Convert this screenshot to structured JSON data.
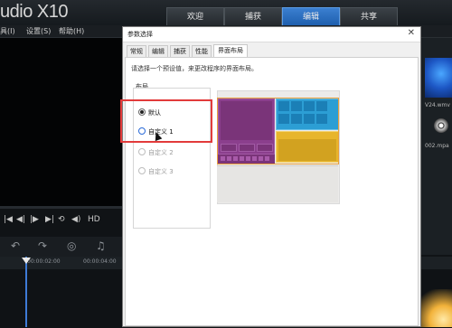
{
  "app": {
    "title": "udio X10",
    "mode_tabs": [
      "欢迎",
      "捕获",
      "编辑",
      "共享"
    ],
    "menu": [
      "具(I)",
      "设置(S)",
      "帮助(H)"
    ],
    "controls": [
      "HD"
    ],
    "ruler": [
      "00:00:02:00",
      "00:00:04:00"
    ],
    "thumb_labels": [
      "V24.wmv",
      "002.mpa"
    ],
    "accent": "#2d7bd8"
  },
  "dialog": {
    "title": "参数选择",
    "tabs": [
      "常规",
      "编辑",
      "捕获",
      "性能",
      "界面布局"
    ],
    "active_tab": "界面布局",
    "description": "请选择一个预设值，来更改程序的界面布局。",
    "group_label": "布局",
    "options": [
      {
        "label": "默认",
        "checked": true,
        "enabled": true
      },
      {
        "label": "自定义 1",
        "checked": false,
        "enabled": true
      },
      {
        "label": "自定义 2",
        "checked": false,
        "enabled": false
      },
      {
        "label": "自定义 3",
        "checked": false,
        "enabled": false
      }
    ],
    "highlight_color": "#e23a3a"
  }
}
